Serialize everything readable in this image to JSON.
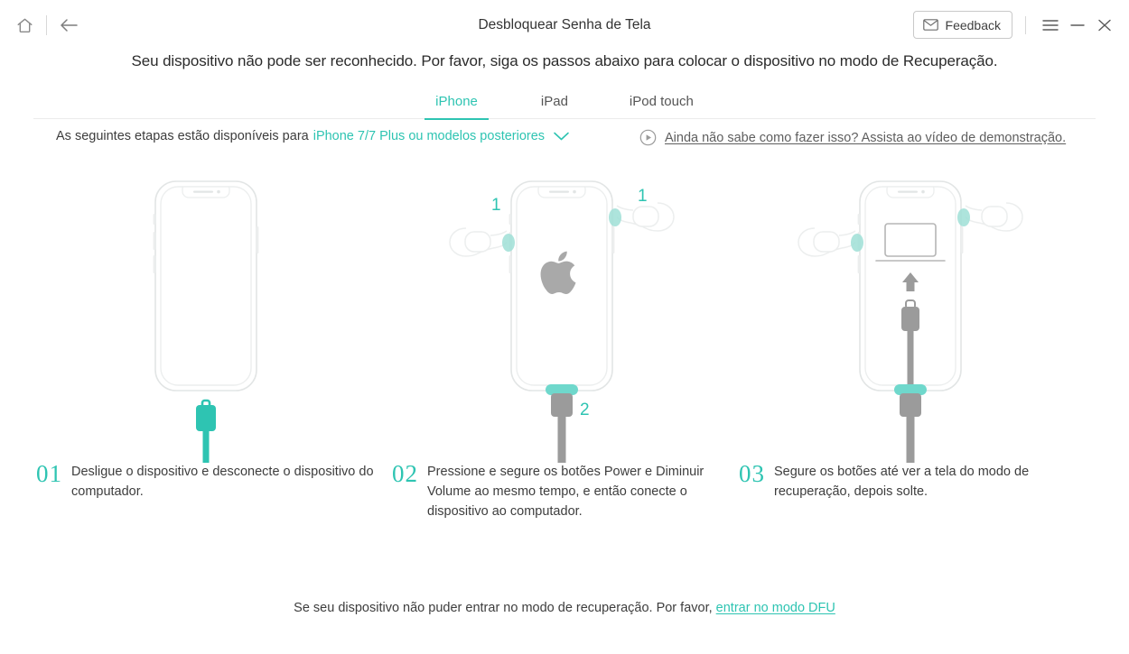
{
  "window": {
    "title": "Desbloquear Senha de Tela",
    "home_icon": "home-icon",
    "back_icon": "back-arrow-icon",
    "feedback_label": "Feedback",
    "feedback_icon": "envelope-icon",
    "menu_icon": "hamburger-menu-icon",
    "minimize_icon": "minimize-icon",
    "close_icon": "close-icon"
  },
  "headline": "Seu dispositivo não pode ser reconhecido. Por favor, siga os passos abaixo para colocar o dispositivo no modo de Recuperação.",
  "tabs": [
    {
      "label": "iPhone",
      "active": true
    },
    {
      "label": "iPad",
      "active": false
    },
    {
      "label": "iPod touch",
      "active": false
    }
  ],
  "subheader": {
    "prefix": "As seguintes etapas estão disponíveis para",
    "model": "iPhone 7/7 Plus ou modelos posteriores",
    "chevron_icon": "chevron-down-icon",
    "video_icon": "play-circle-icon",
    "video_text": "Ainda não sabe como fazer isso? Assista ao vídeo de demonstração."
  },
  "steps": [
    {
      "number": "01",
      "text": "Desligue o dispositivo e desconecte o dispositivo do computador."
    },
    {
      "number": "02",
      "text": "Pressione e segure os botões Power e Diminuir Volume ao mesmo tempo, e então conecte o dispositivo ao computador."
    },
    {
      "number": "03",
      "text": "Segure os botões até ver a tela do modo de recuperação, depois solte."
    }
  ],
  "illustrations": {
    "phone2_badges": {
      "left": "1",
      "right": "1",
      "cable": "2"
    },
    "phone2_screen_icon": "apple-logo-icon",
    "phone3_screen_icons": [
      "computer-icon",
      "up-arrow-icon",
      "lightning-cable-icon"
    ]
  },
  "footer": {
    "text": "Se seu dispositivo não puder entrar no modo de recuperação. Por favor,",
    "link": "entrar no modo DFU"
  },
  "colors": {
    "accent": "#2EC4B2",
    "outline": "#E4E6E6",
    "text": "#333333"
  }
}
